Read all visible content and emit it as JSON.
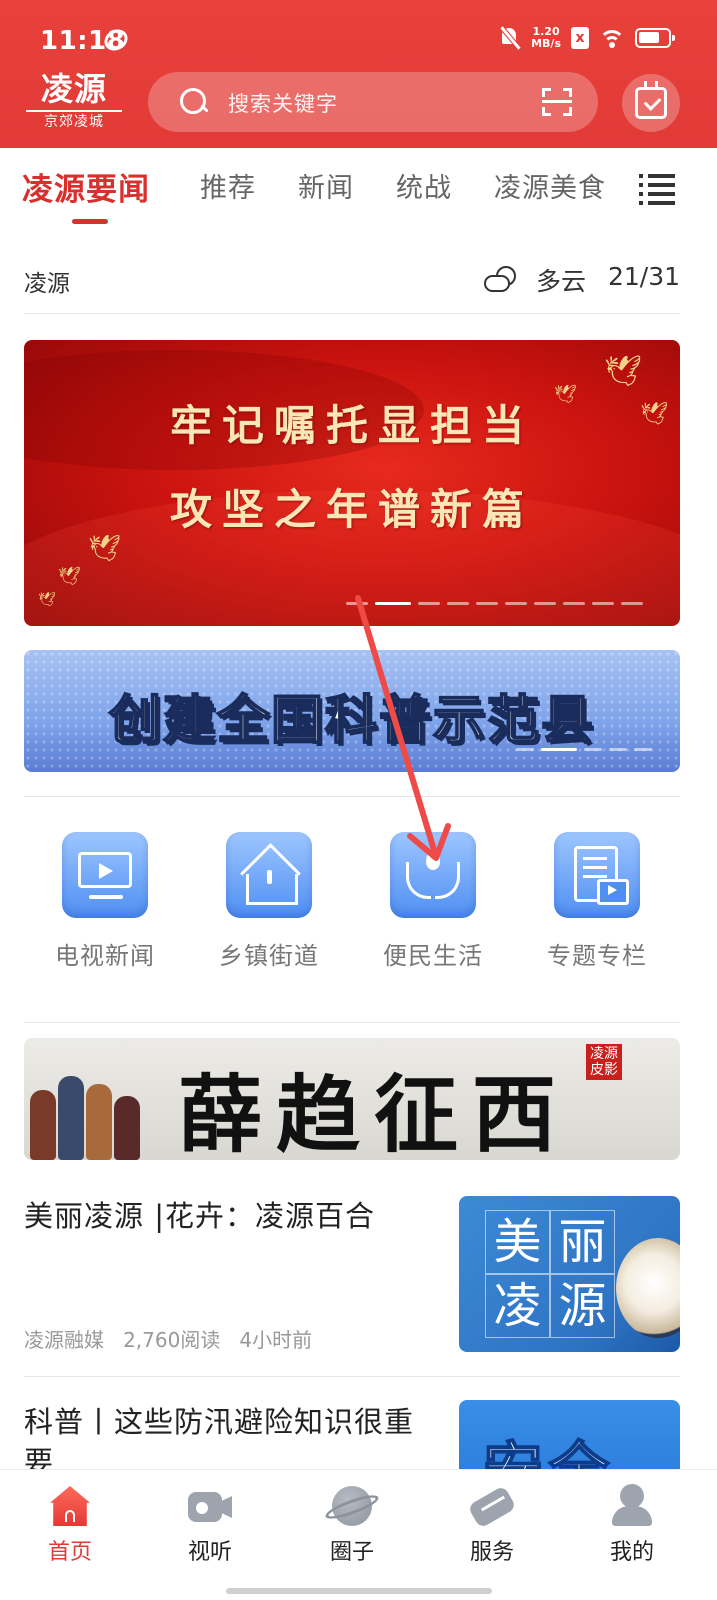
{
  "status_bar": {
    "time": "11:18",
    "net_speed_value": "1.20",
    "net_speed_unit": "MB/s",
    "sim_label": "x"
  },
  "header": {
    "logo_main": "凌源",
    "logo_sub": "京郊凌城",
    "search_placeholder": "搜索关键字"
  },
  "channel_tabs": {
    "items": [
      {
        "label": "凌源要闻",
        "active": true
      },
      {
        "label": "推荐",
        "active": false
      },
      {
        "label": "新闻",
        "active": false
      },
      {
        "label": "统战",
        "active": false
      },
      {
        "label": "凌源美食",
        "active": false
      }
    ]
  },
  "weather": {
    "city": "凌源",
    "condition": "多云",
    "temperature": "21/31",
    "icon": "partly-cloudy-icon"
  },
  "hero_banner": {
    "line1": "牢记嘱托显担当",
    "line2": "攻坚之年谱新篇",
    "slide_count": 10,
    "active_slide": 2
  },
  "science_banner": {
    "title": "创建全国科普示范县",
    "slide_count": 6,
    "active_slide": 2
  },
  "shortcuts": [
    {
      "label": "电视新闻",
      "icon": "tv-icon"
    },
    {
      "label": "乡镇街道",
      "icon": "home-icon"
    },
    {
      "label": "便民生活",
      "icon": "helping-hands-icon"
    },
    {
      "label": "专题专栏",
      "icon": "document-video-icon"
    }
  ],
  "opera_banner": {
    "title": "薛趋征西",
    "seal_line1": "凌源",
    "seal_line2": "皮影"
  },
  "news": [
    {
      "title": "美丽凌源 |花卉：凌源百合",
      "source": "凌源融媒",
      "reads": "2,760阅读",
      "time": "4小时前",
      "thumb_chars": [
        "美",
        "丽",
        "凌",
        "源"
      ]
    },
    {
      "title": "科普丨这些防汛避险知识很重要",
      "thumb_text": "安全"
    }
  ],
  "bottom_nav": {
    "items": [
      {
        "label": "首页",
        "icon": "home-icon",
        "active": true
      },
      {
        "label": "视听",
        "icon": "video-camera-icon",
        "active": false
      },
      {
        "label": "圈子",
        "icon": "planet-icon",
        "active": false
      },
      {
        "label": "服务",
        "icon": "handshake-icon",
        "active": false
      },
      {
        "label": "我的",
        "icon": "user-icon",
        "active": false
      }
    ]
  },
  "colors": {
    "brand_red": "#e23a36",
    "active_tab": "#d8302c",
    "shortcut_blue": "#4f8ff2",
    "annotation_arrow": "#ee4a48"
  }
}
